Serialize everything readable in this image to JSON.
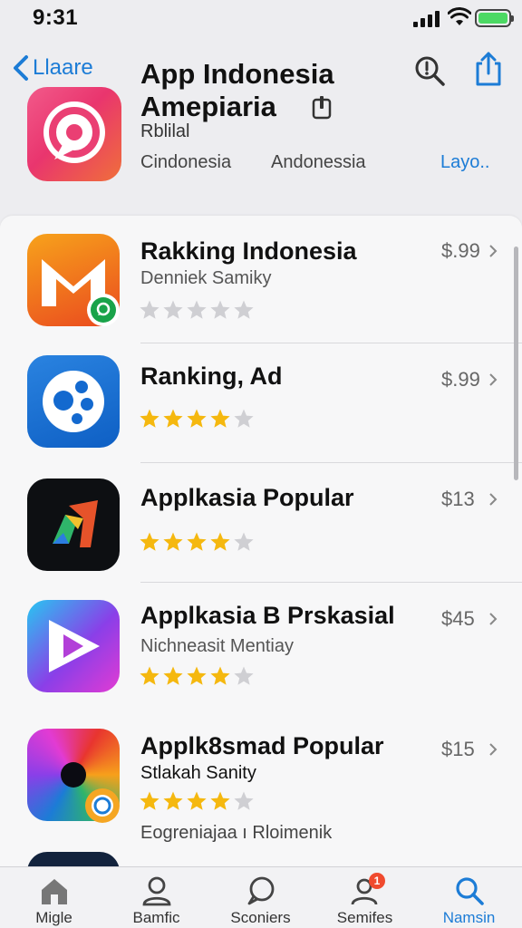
{
  "status_bar": {
    "time": "9:31"
  },
  "header": {
    "back_label": "Llaare",
    "title_line1": "App Indonesia",
    "title_line2": "Amepiaria",
    "subtitle": "Rblilal",
    "meta1": "Cindonesia",
    "meta2": "Andonessia",
    "action_label": "Layo..",
    "icons": [
      "chevron-left-icon",
      "search-icon",
      "share-icon",
      "lock-icon"
    ]
  },
  "apps": [
    {
      "name": "Rakking Indonesia",
      "developer": "Denniek Samiky",
      "price": "$.99",
      "rating": 0
    },
    {
      "name": "Ranking, Ad",
      "developer": "",
      "price": "$.99",
      "rating": 4
    },
    {
      "name": "Applkasia Popular",
      "developer": "",
      "price": "$13",
      "rating": 4
    },
    {
      "name": "Applkasia B Prskasial",
      "developer": "Nichneasit Mentiay",
      "price": "$45",
      "rating": 4
    },
    {
      "name": "Applk8smad Popular",
      "developer": "Stlakah Sanity",
      "price": "$15",
      "rating": 4,
      "extra": "Eogreniajaa ı Rloimenik"
    }
  ],
  "tabs": [
    {
      "label": "Migle",
      "icon": "home-icon"
    },
    {
      "label": "Bamfic",
      "icon": "person-icon"
    },
    {
      "label": "Sconiers",
      "icon": "chat-icon"
    },
    {
      "label": "Semifes",
      "icon": "people-icon",
      "badge": "1"
    },
    {
      "label": "Namsin",
      "icon": "search-icon",
      "active": true
    }
  ],
  "colors": {
    "accent": "#1c7cd6",
    "star": "#f5b80f",
    "star_empty": "#cfcfd3"
  }
}
